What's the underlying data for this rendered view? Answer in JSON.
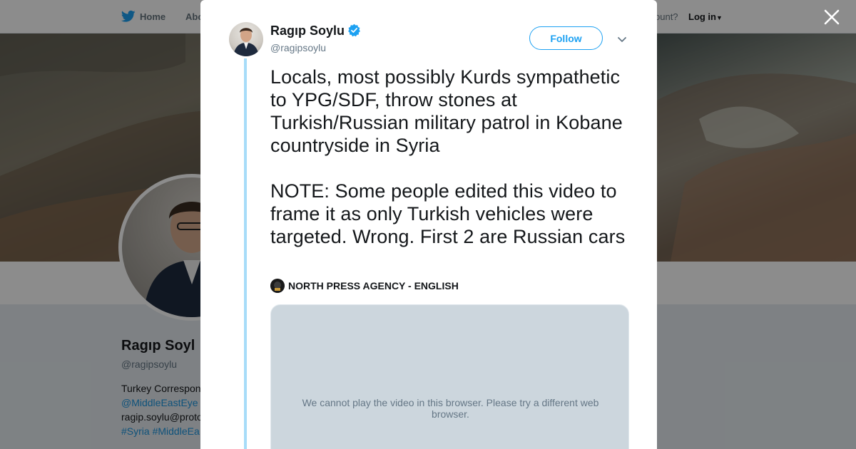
{
  "background_page": {
    "nav": {
      "home_label": "Home",
      "about_label": "Abo",
      "account_prompt": "ccount?",
      "login_label": "Log in"
    },
    "profile": {
      "name": "Ragıp Soyl",
      "handle": "@ragipsoylu",
      "bio_line1": "Turkey Correspon",
      "bio_link": "@MiddleEastEye",
      "bio_email": "ragip.soylu@proto",
      "bio_hashtags": "#Syria #MiddleEa"
    }
  },
  "modal": {
    "author_name": "Ragıp Soylu",
    "author_handle": "@ragipsoylu",
    "follow_label": "Follow",
    "tweet_text": "Locals, most possibly Kurds sympathetic to YPG/SDF, throw stones at Turkish/Russian military patrol in Kobane countryside in Syria\n\nNOTE: Some people edited this video to frame it as only Turkish vehicles were targeted. Wrong. First 2 are Russian cars",
    "quoted_source": "NORTH PRESS AGENCY - ENGLISH",
    "video_message": "We cannot play the video in this browser. Please try a different web browser."
  },
  "icons": {
    "close": "close-icon",
    "verified": "verified-badge-icon",
    "caret": "chevron-down-icon",
    "twitter": "twitter-bird-icon"
  },
  "colors": {
    "accent": "#1da1f2",
    "thread_line": "#a7dcf9",
    "video_bg": "#ccd6dd"
  }
}
